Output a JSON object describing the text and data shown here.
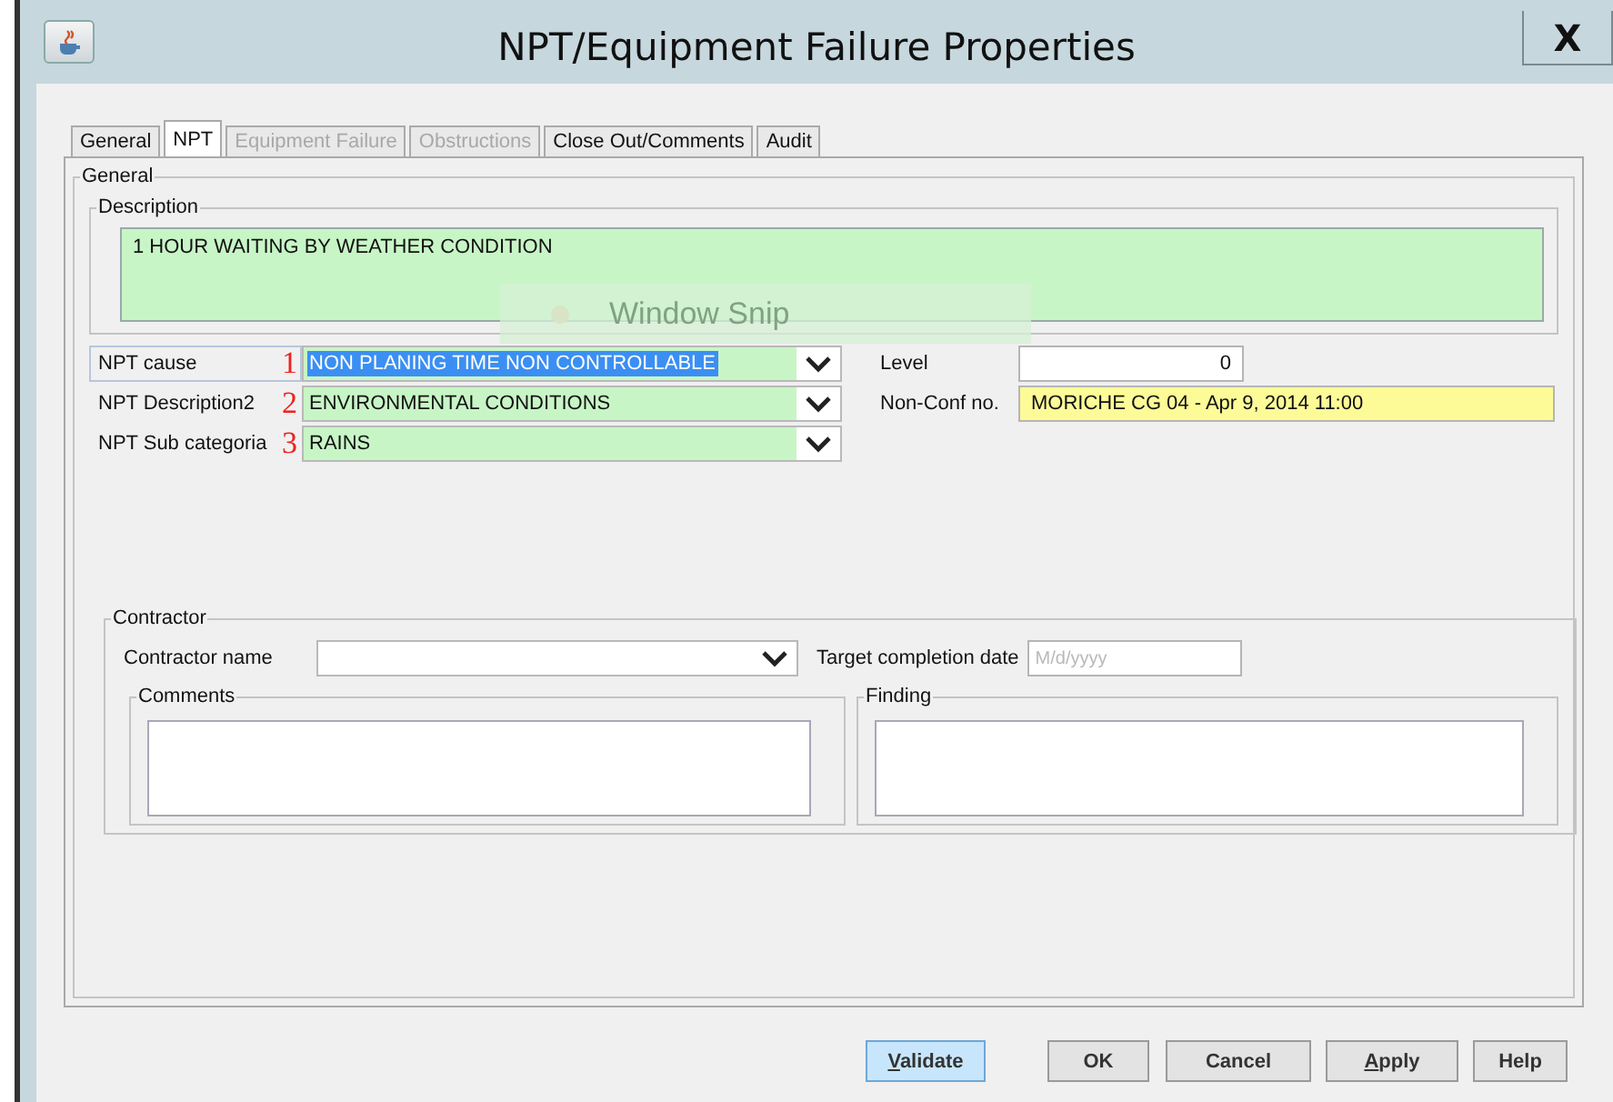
{
  "window": {
    "title": "NPT/Equipment Failure Properties",
    "close": "X"
  },
  "tabs": [
    {
      "label": "General",
      "selected": false,
      "disabled": false
    },
    {
      "label": "NPT",
      "selected": true,
      "disabled": false
    },
    {
      "label": "Equipment Failure",
      "selected": false,
      "disabled": true
    },
    {
      "label": "Obstructions",
      "selected": false,
      "disabled": true
    },
    {
      "label": "Close Out/Comments",
      "selected": false,
      "disabled": false
    },
    {
      "label": "Audit",
      "selected": false,
      "disabled": false
    }
  ],
  "general": {
    "title": "General",
    "description": {
      "title": "Description",
      "value": "1 HOUR WAITING BY WEATHER CONDITION"
    },
    "snip_overlay": {
      "label": "Window Snip"
    },
    "npt_fields": [
      {
        "label": "NPT cause",
        "annotation": "1",
        "value": "NON PLANING TIME NON CONTROLLABLE",
        "highlighted": true,
        "focused": true
      },
      {
        "label": "NPT Description2",
        "annotation": "2",
        "value": "ENVIRONMENTAL CONDITIONS",
        "highlighted": false,
        "focused": false
      },
      {
        "label": "NPT Sub categoria",
        "annotation": "3",
        "value": "RAINS",
        "highlighted": false,
        "focused": false
      }
    ],
    "side_fields": [
      {
        "label": "Level",
        "value": "0",
        "read_only": false
      },
      {
        "label": "Non-Conf no.",
        "value": "MORICHE CG 04 - Apr 9, 2014 11:00",
        "read_only": true
      }
    ],
    "contractor": {
      "title": "Contractor",
      "name_label": "Contractor name",
      "date_label": "Target completion date",
      "date_placeholder": "M/d/yyyy",
      "comments": {
        "title": "Comments"
      },
      "finding": {
        "title": "Finding"
      }
    }
  },
  "buttons": [
    {
      "label": "Validate",
      "default": true,
      "mnemonic": true
    },
    {
      "label": "OK",
      "default": false,
      "mnemonic": false
    },
    {
      "label": "Cancel",
      "default": false,
      "mnemonic": false
    },
    {
      "label": "Apply",
      "default": false,
      "mnemonic": true
    },
    {
      "label": "Help",
      "default": false,
      "mnemonic": false
    }
  ]
}
